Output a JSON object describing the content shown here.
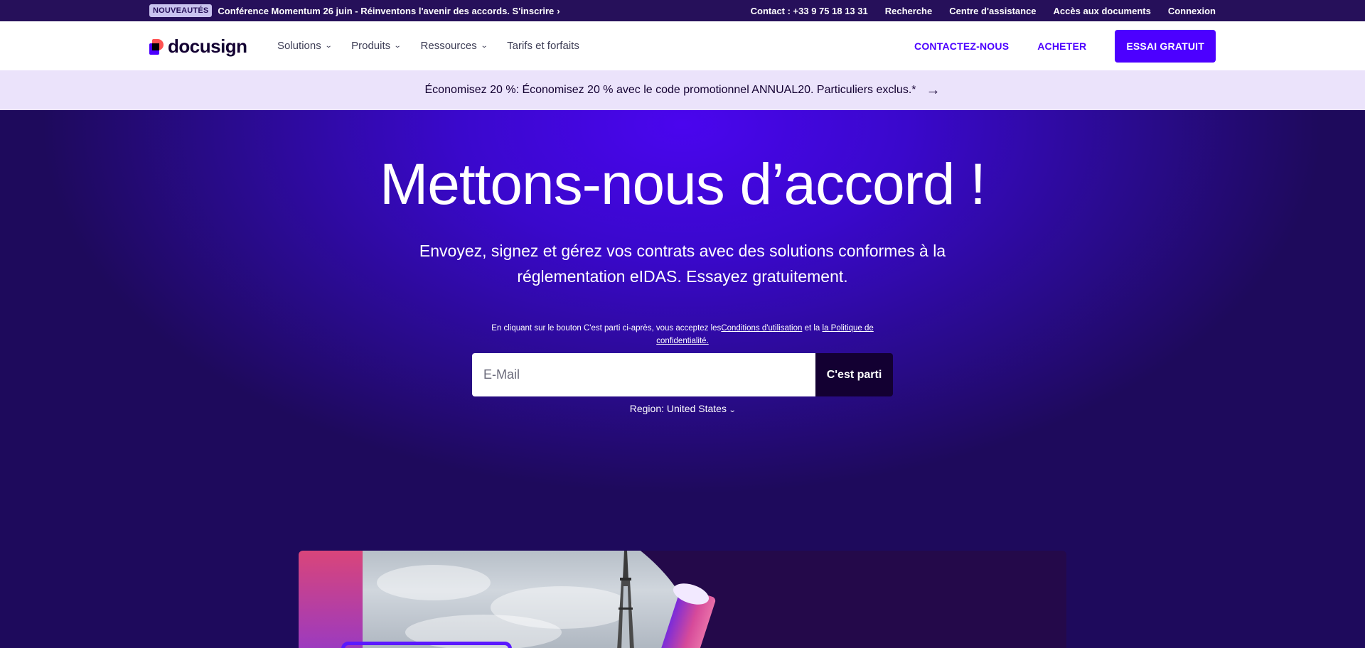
{
  "topbar": {
    "badge": "NOUVEAUTÉS",
    "announcement": "Conférence Momentum 26 juin - Réinventons l'avenir des accords. S'inscrire",
    "links": [
      "Contact : +33 9 75 18 13 31",
      "Recherche",
      "Centre d'assistance",
      "Accès aux documents",
      "Connexion"
    ]
  },
  "nav": {
    "logo_text": "docusign",
    "menu": [
      {
        "label": "Solutions",
        "has_dropdown": true
      },
      {
        "label": "Produits",
        "has_dropdown": true
      },
      {
        "label": "Ressources",
        "has_dropdown": true
      },
      {
        "label": "Tarifs et forfaits",
        "has_dropdown": false
      }
    ],
    "contact_label": "CONTACTEZ-NOUS",
    "buy_label": "ACHETER",
    "trial_label": "ESSAI GRATUIT"
  },
  "promo": {
    "text": "Économisez 20 %: Économisez 20 % avec le code promotionnel ANNUAL20. Particuliers exclus.*"
  },
  "hero": {
    "headline": "Mettons-nous d’accord !",
    "subhead": "Envoyez, signez et gérez vos contrats avec des solutions conformes à la réglementation eIDAS. Essayez gratuitement.",
    "legal_prefix": "En cliquant sur le bouton C'est parti ci-après, vous acceptez les",
    "legal_terms_link": "Conditions d'utilisation",
    "legal_middle": " et la ",
    "legal_privacy_link": "la Politique de confidentialité.",
    "email_placeholder": "E-Mail",
    "submit_label": "C'est parti",
    "region_label": "Region: United States"
  },
  "colors": {
    "brand_purple": "#4c00ff",
    "deep_navy": "#130032",
    "topbar_bg": "#26105a",
    "promo_bg": "#ebe3fb"
  }
}
